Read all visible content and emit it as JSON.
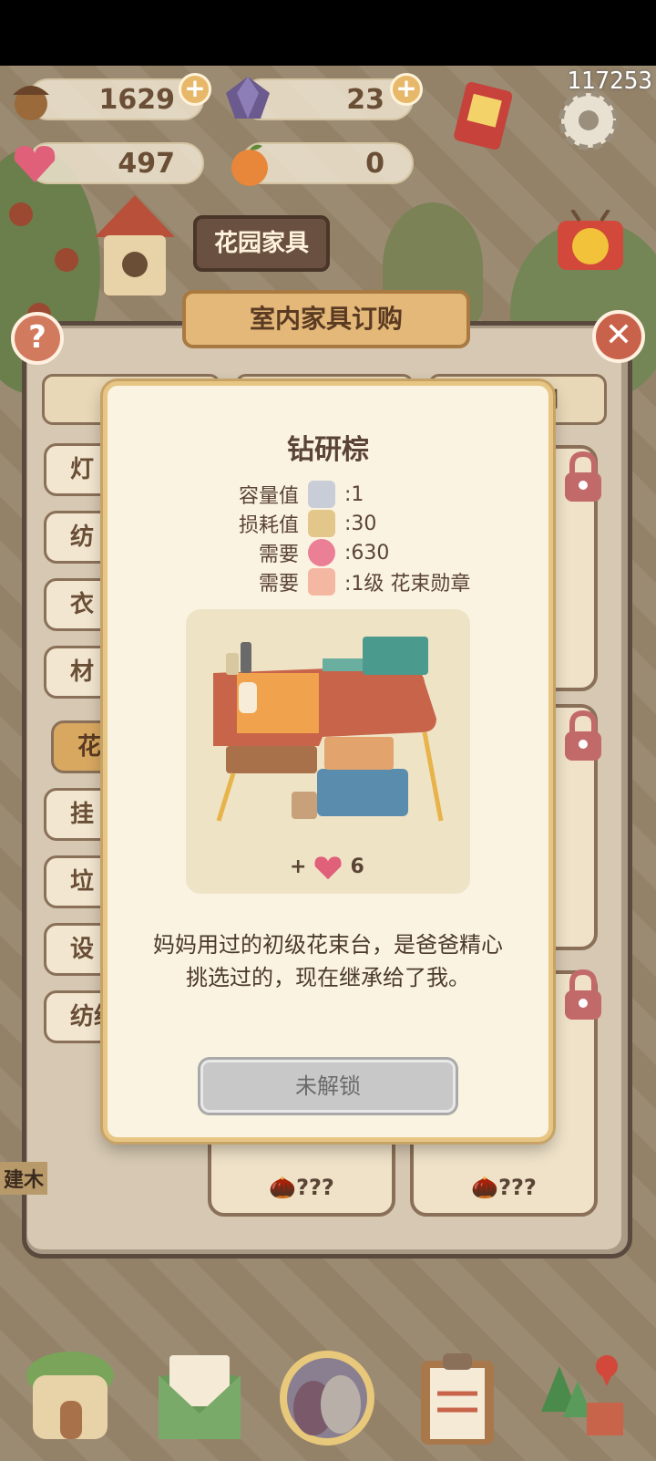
{
  "resources": {
    "acorn": "1629",
    "gem": "23",
    "heart": "497",
    "orange": "0"
  },
  "corner_code": "117253",
  "category_sign": "花园家具",
  "panel_title": "室内家具订购",
  "side_tabs": [
    "灯",
    "纺",
    "衣",
    "材",
    "花",
    "挂",
    "垃",
    "设",
    "纺织"
  ],
  "top_tab_fragment": "间",
  "card_prices": [
    "???",
    "???"
  ],
  "modal": {
    "title": "钻研棕",
    "stats": [
      {
        "label": "容量值",
        "value": ":1"
      },
      {
        "label": "损耗值",
        "value": ":30"
      },
      {
        "label": "需要",
        "value": ":630"
      },
      {
        "label": "需要",
        "value": ":1级 花束勋章"
      }
    ],
    "reward_plus": "+",
    "reward_value": "6",
    "description_line1": "妈妈用过的初级花束台，是爸爸精心",
    "description_line2": "挑选过的，现在继承给了我。",
    "button_label": "未解锁"
  },
  "side_partial_label": "建木",
  "colors": {
    "modal_bg": "#fbf3e1",
    "modal_border": "#e7c684",
    "panel_bg": "#a99a86",
    "accent": "#d8a860"
  }
}
